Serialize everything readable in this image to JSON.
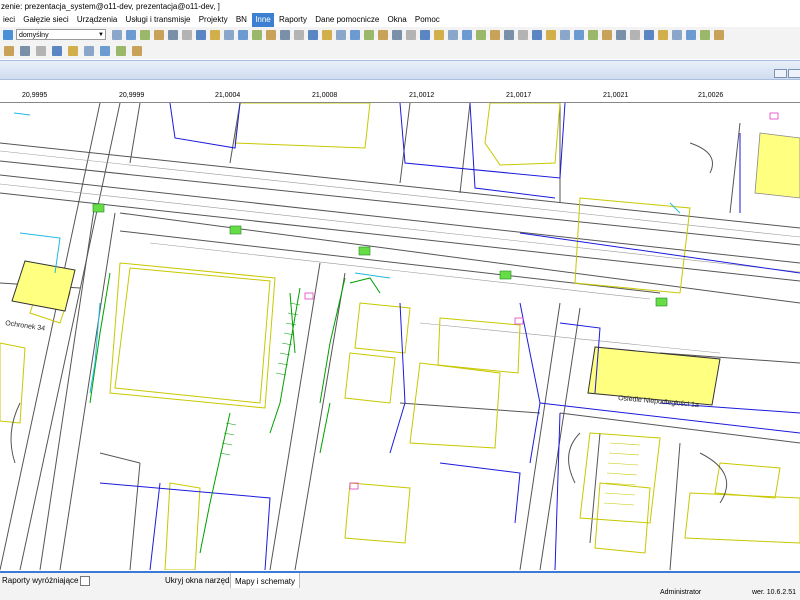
{
  "window": {
    "title": "zenie: prezentacja_system@o11-dev, prezentacja@o11-dev, ]"
  },
  "menu": [
    "ieci",
    "Gałęzie sieci",
    "Urządzenia",
    "Usługi i transmisje",
    "Projekty",
    "BN",
    "Inne",
    "Raporty",
    "Dane pomocnicze",
    "Okna",
    "Pomoc"
  ],
  "menu_active": "Inne",
  "toolbar": {
    "style_select_value": "domyślny"
  },
  "ruler": {
    "labels": [
      "20,9995",
      "20,9999",
      "21,0004",
      "21,0008",
      "21,0012",
      "21,0017",
      "21,0021",
      "21,0026"
    ]
  },
  "map": {
    "labels": {
      "building_1": "Ochronek 34",
      "building_2": "Osiedle Niepodległości 1a"
    },
    "colors": {
      "road": "#555555",
      "building_outline": "#c8c800",
      "building_fill": "#ffff80",
      "cable_blue": "#1a1adc",
      "duct_green": "#00a000",
      "node_green": "#66dd44",
      "cyan": "#20b8e0",
      "pink": "#e040c0"
    }
  },
  "status": {
    "reports_label": "Raporty wyróżniające",
    "hide_toolbar_label": "Ukryj okna narzędzi",
    "maps_tab_label": "Mapy i schematy"
  },
  "bottom": {
    "user": "Administrator",
    "version": "wer. 10.6.2.51"
  }
}
